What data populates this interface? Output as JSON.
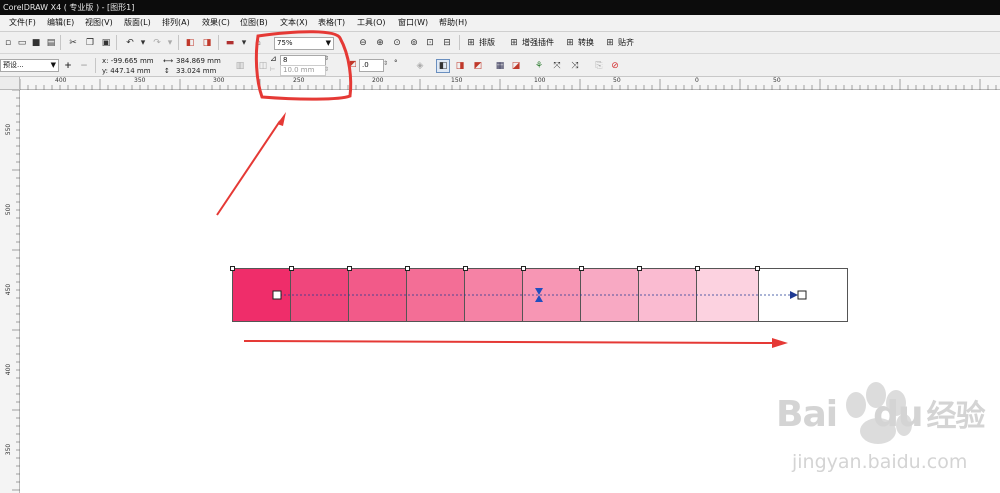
{
  "window": {
    "title": "CorelDRAW X4 ( 专业版 ) - [图形1]"
  },
  "menus": [
    "文件(F)",
    "编辑(E)",
    "视图(V)",
    "版面(L)",
    "排列(A)",
    "效果(C)",
    "位图(B)",
    "文本(X)",
    "表格(T)",
    "工具(O)",
    "窗口(W)",
    "帮助(H)"
  ],
  "toolbar": {
    "zoom": "75%",
    "buttons": [
      "排版",
      "增强插件",
      "转换",
      "贴齐"
    ]
  },
  "property_bar": {
    "preset": "预设...",
    "x": "x: -99.665 mm",
    "y": "y: 447.14 mm",
    "width": "384.869 mm",
    "height": "33.024 mm",
    "steps": "8",
    "spacing": "10.0 mm",
    "angle": ".0",
    "degree": "°"
  },
  "ruler": {
    "h": [
      "400",
      "350",
      "300",
      "250",
      "200",
      "150",
      "100",
      "50",
      "0",
      "50"
    ],
    "v": [
      "550",
      "500",
      "450",
      "400",
      "350"
    ]
  },
  "blend": {
    "colors": [
      "#ef2d6a",
      "#f0467c",
      "#f25a89",
      "#f36e96",
      "#f582a5",
      "#f796b4",
      "#f8a9c3",
      "#fabbd1",
      "#fcd2e0"
    ]
  },
  "annotation_color": "#e53935",
  "watermark": {
    "brand_a": "Bai",
    "brand_b": "du",
    "brand_c": "经验",
    "url": "jingyan.baidu.com"
  }
}
